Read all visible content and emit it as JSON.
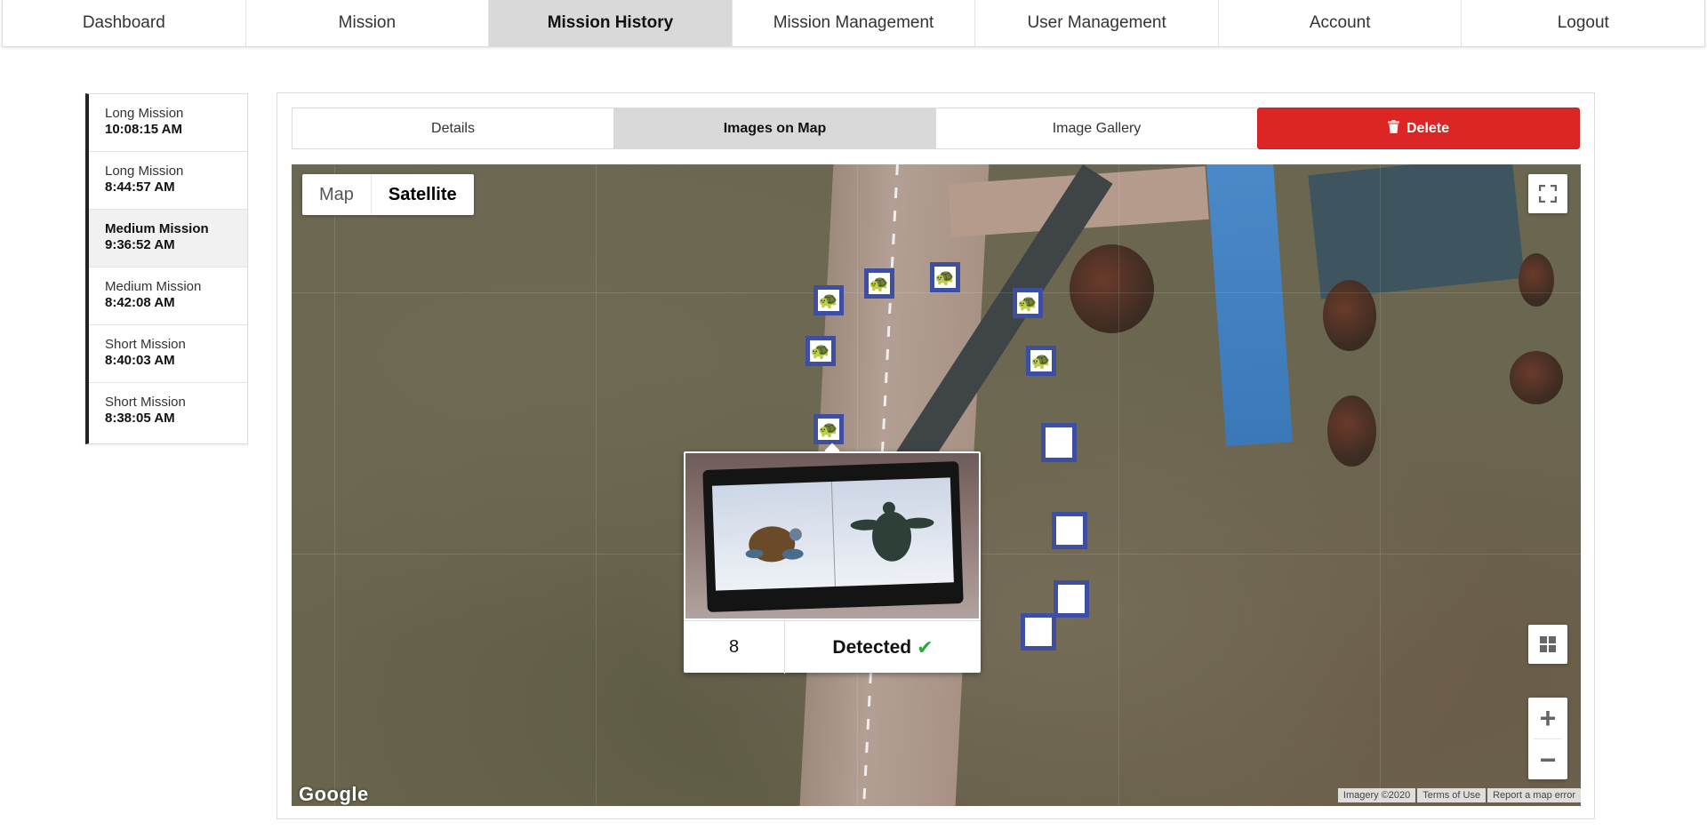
{
  "nav": {
    "items": [
      {
        "label": "Dashboard"
      },
      {
        "label": "Mission"
      },
      {
        "label": "Mission History"
      },
      {
        "label": "Mission Management"
      },
      {
        "label": "User Management"
      },
      {
        "label": "Account"
      },
      {
        "label": "Logout"
      }
    ],
    "active": "Mission History"
  },
  "sidebar": {
    "missions": [
      {
        "name": "Long Mission",
        "time": "10:08:15 AM"
      },
      {
        "name": "Long Mission",
        "time": "8:44:57 AM"
      },
      {
        "name": "Medium Mission",
        "time": "9:36:52 AM"
      },
      {
        "name": "Medium Mission",
        "time": "8:42:08 AM"
      },
      {
        "name": "Short Mission",
        "time": "8:40:03 AM"
      },
      {
        "name": "Short Mission",
        "time": "8:38:05 AM"
      }
    ],
    "active_index": 2
  },
  "tabs": {
    "details": "Details",
    "images_on_map": "Images on Map",
    "image_gallery": "Image Gallery",
    "delete": "Delete",
    "active": "Images on Map"
  },
  "map": {
    "type_map": "Map",
    "type_satellite": "Satellite",
    "active_type": "Satellite",
    "google_logo": "Google",
    "attribution": {
      "imagery": "Imagery ©2020",
      "terms": "Terms of Use",
      "report": "Report a map error"
    },
    "zoom_in": "+",
    "zoom_out": "−",
    "marker_icons": [
      "turtle-icon",
      "blank"
    ],
    "colors": {
      "marker_border": "#3e4ea0",
      "delete_button": "#dc2626",
      "detected_check": "#28a745"
    }
  },
  "infowindow": {
    "count": "8",
    "status": "Detected",
    "status_icon": "check-icon"
  }
}
